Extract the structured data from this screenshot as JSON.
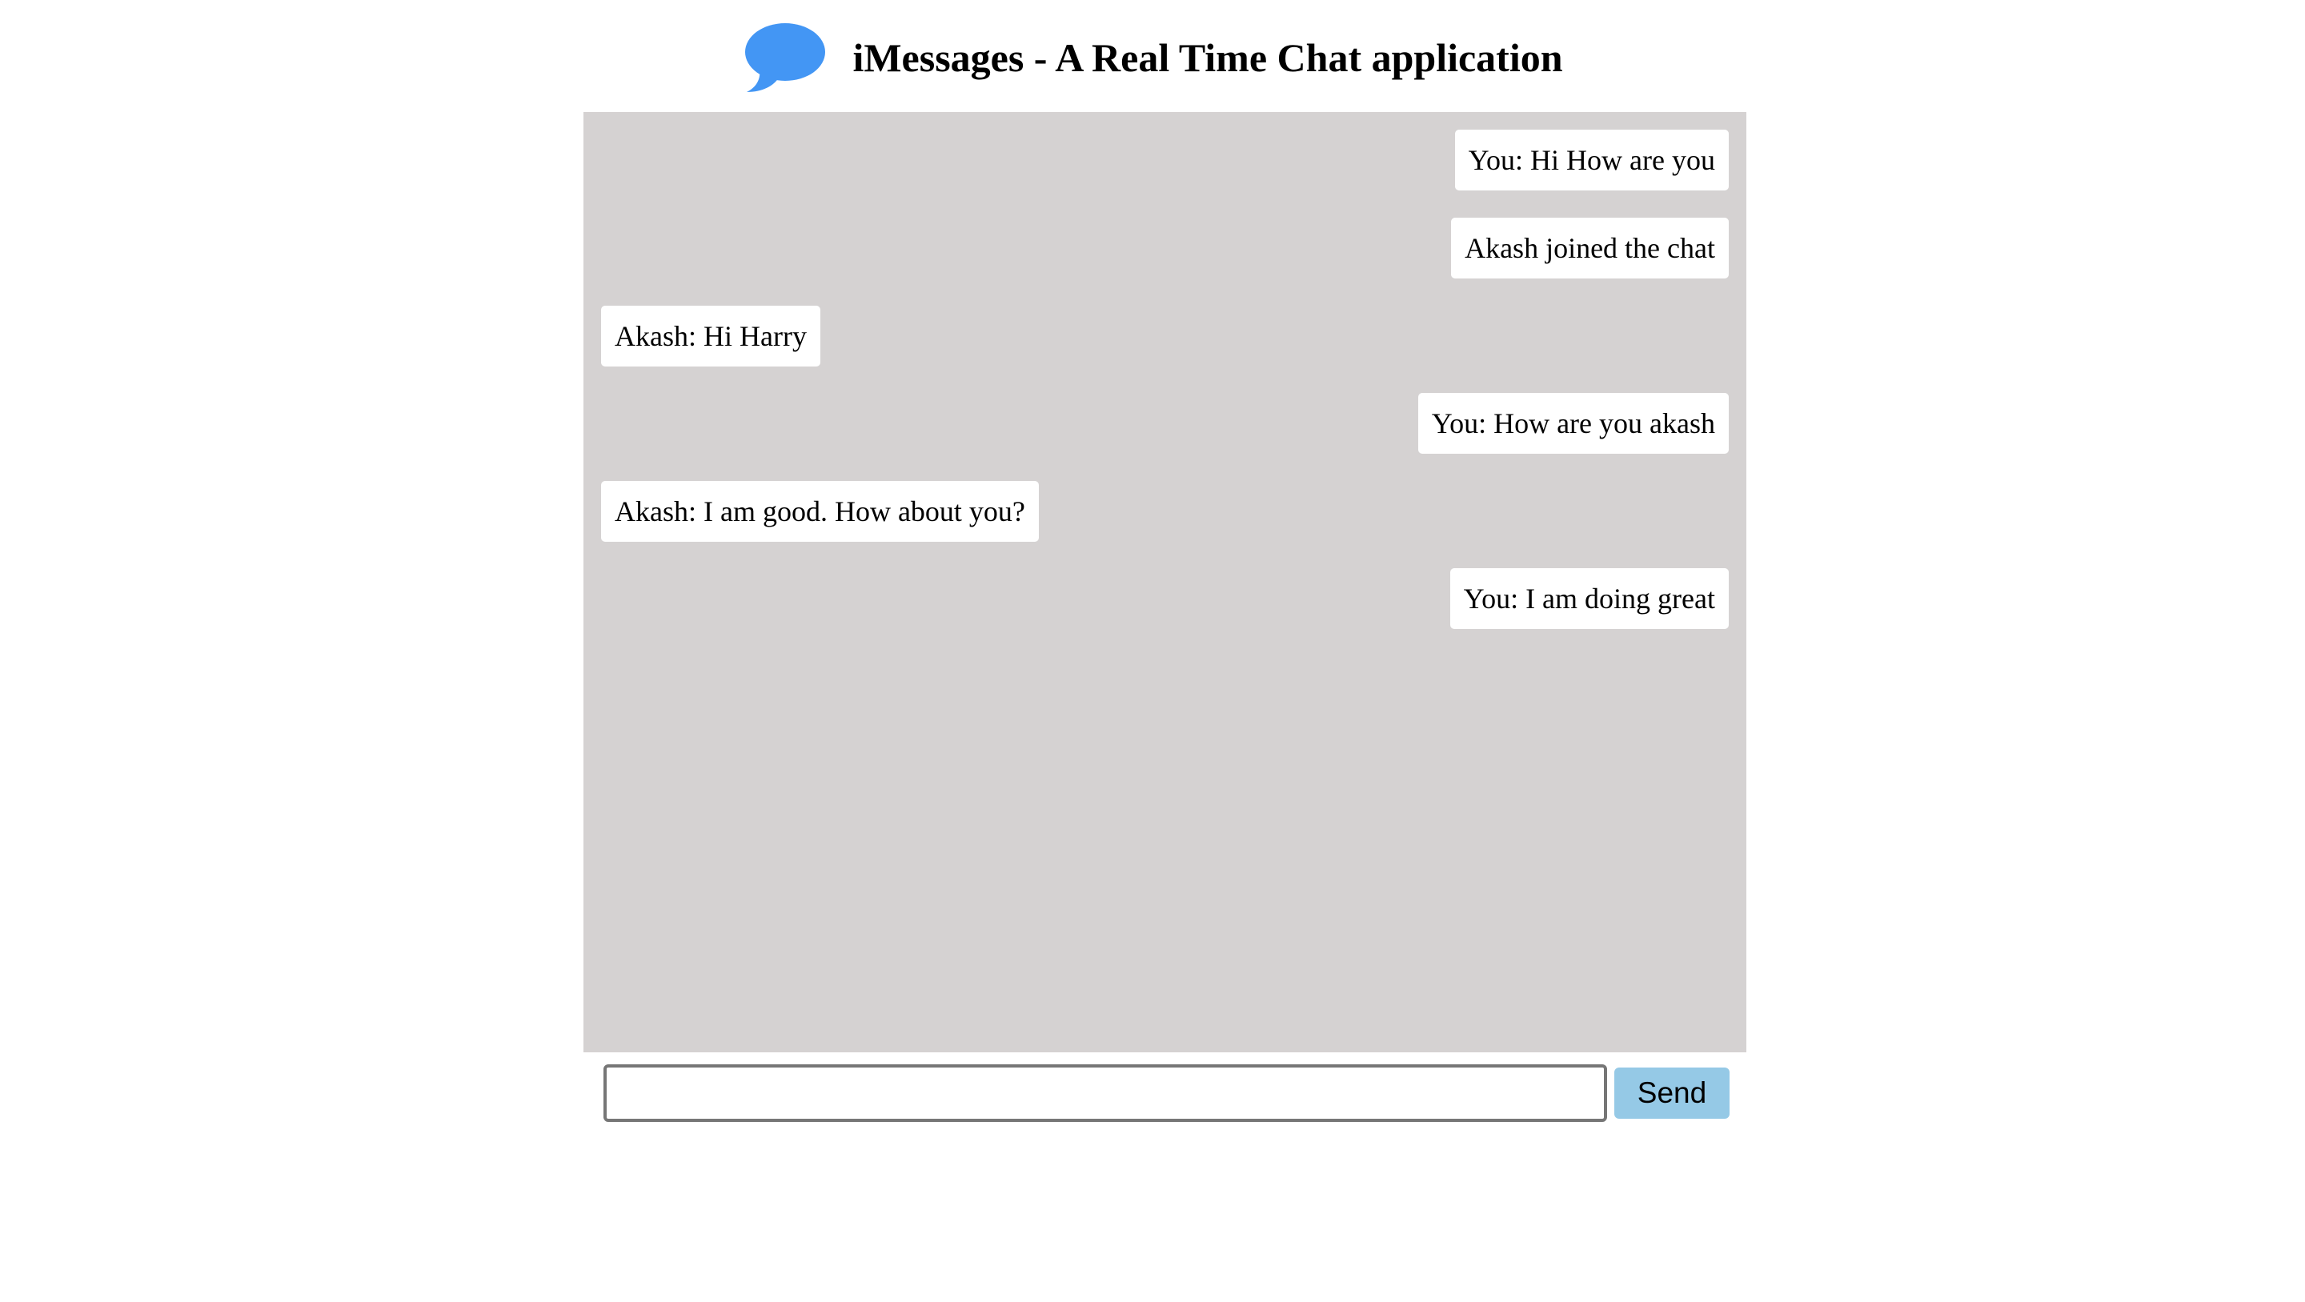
{
  "header": {
    "icon": "chat-bubble-icon",
    "title": "iMessages - A Real Time Chat application"
  },
  "messages": [
    {
      "text": "You: Hi How are you",
      "side": "right"
    },
    {
      "text": "Akash joined the chat",
      "side": "right"
    },
    {
      "text": "Akash: Hi Harry",
      "side": "left"
    },
    {
      "text": "You: How are you akash",
      "side": "right"
    },
    {
      "text": "Akash: I am good. How about you?",
      "side": "left"
    },
    {
      "text": "You: I am doing great",
      "side": "right"
    }
  ],
  "composer": {
    "input_value": "",
    "send_label": "Send"
  },
  "colors": {
    "chat_background": "#d5d2d2",
    "bubble_background": "#ffffff",
    "send_button": "#95c9e6",
    "logo": "#4396f4"
  }
}
